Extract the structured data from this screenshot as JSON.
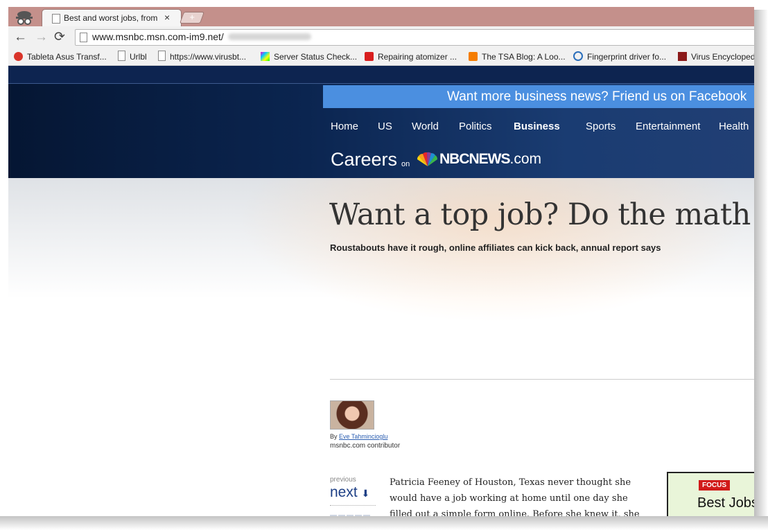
{
  "browser": {
    "tab_title": "Best and worst jobs, from",
    "tab_close": "×",
    "new_tab": "+",
    "back": "←",
    "forward": "→",
    "reload": "⟳",
    "url": "www.msnbc.msn.com-im9.net/"
  },
  "bookmarks": [
    {
      "label": "Tableta Asus Transf...",
      "icon": "e-icon",
      "color": "#d9342a"
    },
    {
      "label": "Urlbl",
      "icon": "page-icon",
      "color": "#ffffff"
    },
    {
      "label": "https://www.virusbt...",
      "icon": "page-icon",
      "color": "#ffffff"
    },
    {
      "label": "Server Status Check...",
      "icon": "color-grid-icon",
      "color": "#f0c"
    },
    {
      "label": "Repairing atomizer ...",
      "icon": "youtube-icon",
      "color": "#d81e1e"
    },
    {
      "label": "The TSA Blog: A Loo...",
      "icon": "blogger-icon",
      "color": "#f57d00"
    },
    {
      "label": "Fingerprint driver fo...",
      "icon": "dell-icon",
      "color": "#2a6ebb"
    },
    {
      "label": "Virus Encycloped",
      "icon": "b-icon",
      "color": "#8b1a1a"
    }
  ],
  "site": {
    "promo": "Want more business news? Friend us on Facebook",
    "nav": [
      "Home",
      "US",
      "World",
      "Politics",
      "Business",
      "Sports",
      "Entertainment",
      "Health"
    ],
    "active_nav": "Business",
    "section": "Careers",
    "on": "on",
    "logo_main": "NBCNEWS",
    "logo_suffix": ".com"
  },
  "article": {
    "headline": "Want a top job? Do the math",
    "subhead": "Roustabouts have it rough, online affiliates can kick back, annual report says",
    "by": "By",
    "author": "Eve Tahmincioglu",
    "author_role": "msnbc.com contributor",
    "previous": "previous",
    "next": "next",
    "body": [
      "Patricia Feeney of Houston, Texas never thought she",
      "would have a job working at home until one day she",
      "filled out a simple form online. Before she knew it, she"
    ],
    "focus_badge": "FOCUS",
    "focus_title": "Best Jobs i"
  }
}
